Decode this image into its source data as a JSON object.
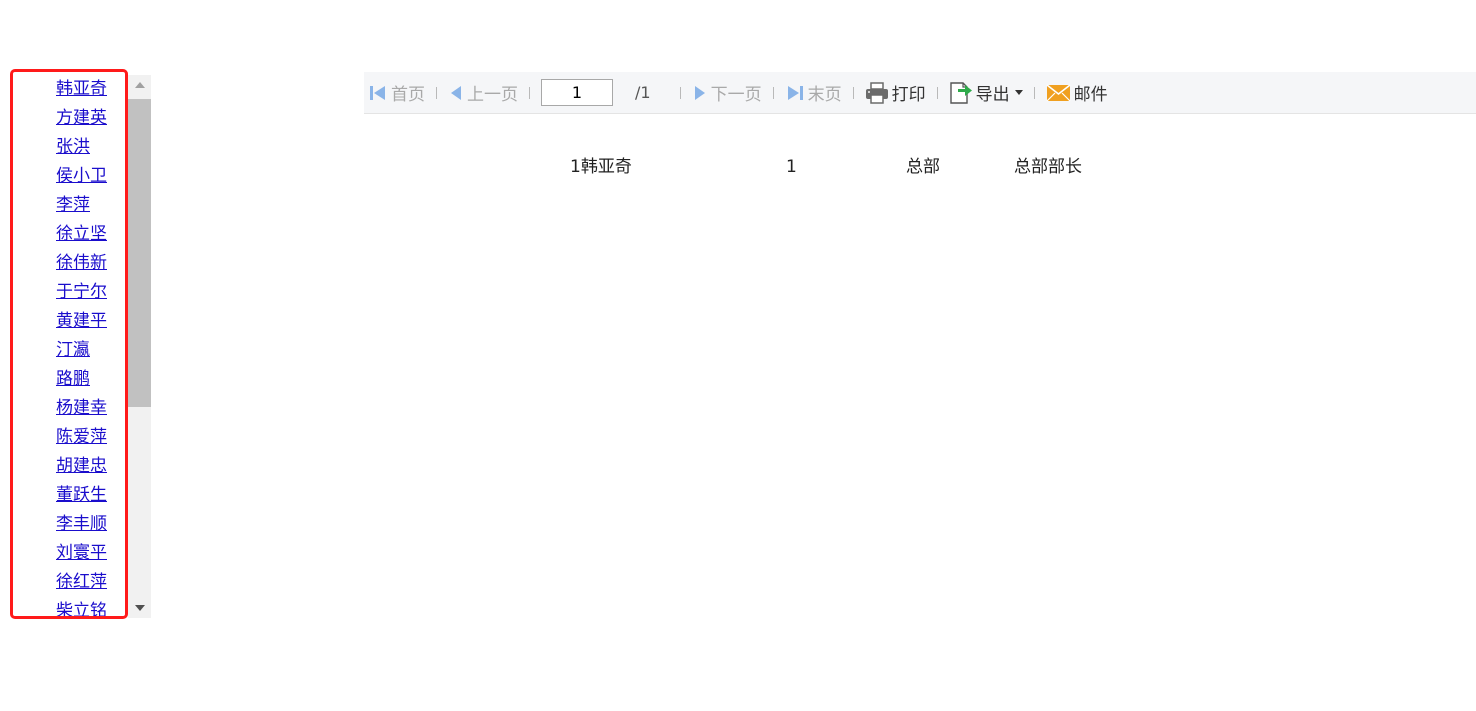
{
  "names": [
    "韩亚奇",
    "方建英",
    "张洪",
    "侯小卫",
    "李萍",
    "徐立坚",
    "徐伟新",
    "于宁尔",
    "黄建平",
    "汀瀛",
    "路鹏",
    "杨建幸",
    "陈爱萍",
    "胡建忠",
    "董跃生",
    "李丰顺",
    "刘寰平",
    "徐红萍",
    "柴立铭"
  ],
  "toolbar": {
    "first": "首页",
    "prev": "上一页",
    "page_value": "1",
    "page_total": "/1",
    "next": "下一页",
    "last": "末页",
    "print": "打印",
    "export": "导出",
    "mail": "邮件"
  },
  "report": {
    "row": [
      "1韩亚奇",
      "1",
      "总部",
      "总部部长"
    ]
  },
  "colors": {
    "link": "#1a0dcc",
    "highlight": "#ff1a1a",
    "disabled": "#a9a9a9",
    "nav_icon": "#8ab4e8",
    "export_icon": "#2eaa4a",
    "mail_icon": "#f0a020"
  },
  "icons": [
    "first-page-icon",
    "prev-page-icon",
    "next-page-icon",
    "last-page-icon",
    "printer-icon",
    "export-icon",
    "caret-down-icon",
    "mail-icon",
    "scroll-up-icon",
    "scroll-down-icon"
  ]
}
